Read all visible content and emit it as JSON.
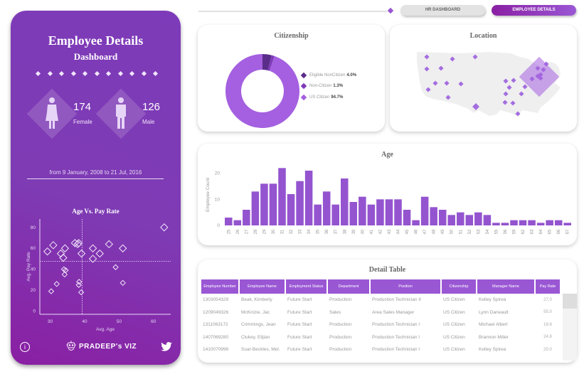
{
  "left_panel": {
    "title": "Employee Details",
    "subtitle": "Dashboard",
    "female": {
      "count": "174",
      "label": "Female"
    },
    "male": {
      "count": "126",
      "label": "Male"
    },
    "date_range": "from 9 January, 2008 to 21 Jul, 2016",
    "brand": "PRADEEP's VIZ",
    "icons": {
      "info": "info-icon",
      "brand": "robot-icon",
      "social": "twitter-icon"
    }
  },
  "nav": {
    "hr_dashboard": "HR DASHBOARD",
    "employee_details": "EMPLOYEE DETAILS"
  },
  "colors": {
    "accent": "#9a57d4",
    "panel": "#7e3bb9",
    "dark_purple": "#5b2d8a",
    "mid_purple": "#7e3bb9",
    "light_purple": "#a460e0"
  },
  "citizenship": {
    "title": "Citizenship",
    "legend": [
      {
        "label": "Eligible NonCitizen",
        "value": "4.0%",
        "color": "#5b2d8a"
      },
      {
        "label": "Non-Citizen",
        "value": "1.3%",
        "color": "#7e3bb9"
      },
      {
        "label": "US Citizen",
        "value": "94.7%",
        "color": "#a460e0"
      }
    ]
  },
  "location": {
    "title": "Location"
  },
  "age_chart": {
    "title": "Age"
  },
  "table": {
    "title": "Detail Table",
    "headers": [
      "Employee Number",
      "Employee Name",
      "Employment Status",
      "Department",
      "Position",
      "Citizenship",
      "Manager Name",
      "Pay Rate"
    ],
    "rows": [
      [
        "1303054329",
        "Beak, Kimberly",
        "Future Start",
        "Production",
        "Production Technician II",
        "US Citizen",
        "Kelley Spirea",
        "27.0"
      ],
      [
        "1209049326",
        "McKinzie, Jac",
        "Future Start",
        "Sales",
        "Area Sales Manager",
        "US Citizen",
        "Lynn Daneault",
        "55.0"
      ],
      [
        "1311063172",
        "Crimmings,   Jean",
        "Future Start",
        "Production",
        "Production Technician I",
        "US Citizen",
        "Michael Albert",
        "19.8"
      ],
      [
        "1407069280",
        "Clukey, Elijian",
        "Future Start",
        "Production",
        "Production Technician I",
        "US Citizen",
        "Brannon Miller",
        "24.8"
      ],
      [
        "1410070998",
        "Soar-Beckles, Mel.",
        "Future Start",
        "Production",
        "Production Technician I",
        "US Citizen",
        "Kelley Spirea",
        "20.0"
      ]
    ]
  },
  "chart_data": [
    {
      "type": "pie",
      "title": "Citizenship",
      "categories": [
        "Eligible NonCitizen",
        "Non-Citizen",
        "US Citizen"
      ],
      "values": [
        4.0,
        1.3,
        94.7
      ],
      "donut": true,
      "legend": "right"
    },
    {
      "type": "bar",
      "title": "Age",
      "xlabel": "",
      "ylabel": "Employee Count",
      "ylim": [
        0,
        24
      ],
      "yticks": [
        0,
        10,
        20
      ],
      "categories": [
        "25",
        "26",
        "27",
        "28",
        "29",
        "30",
        "31",
        "32",
        "33",
        "34",
        "35",
        "36",
        "37",
        "38",
        "39",
        "40",
        "41",
        "42",
        "43",
        "44",
        "45",
        "46",
        "47",
        "48",
        "49",
        "50",
        "51",
        "52",
        "53",
        "54",
        "55",
        "56",
        "59",
        "62",
        "63",
        "64",
        "65",
        "66",
        "67"
      ],
      "values": [
        3,
        2,
        6,
        13,
        16,
        16,
        22,
        12,
        17,
        21,
        8,
        13,
        8,
        18,
        9,
        11,
        8,
        10,
        10,
        10,
        6,
        2,
        11,
        7,
        6,
        4,
        5,
        4,
        5,
        4,
        1,
        1,
        2,
        2,
        2,
        1,
        2,
        2,
        1
      ]
    },
    {
      "type": "scatter",
      "title": "Age Vs. Pay Rate",
      "xlabel": "Avg. Age",
      "ylabel": "Avg. Pay Rate",
      "xlim": [
        27,
        65
      ],
      "ylim": [
        -3,
        88
      ],
      "xticks": [
        30,
        40,
        50,
        60
      ],
      "yticks": [
        0,
        20,
        40,
        60,
        80
      ],
      "reference_lines": {
        "x": 39.3,
        "y": 47.5
      },
      "points": [
        {
          "x": 29.2,
          "y": 57
        },
        {
          "x": 30.9,
          "y": 63
        },
        {
          "x": 33.1,
          "y": 55
        },
        {
          "x": 33.8,
          "y": 51
        },
        {
          "x": 34.3,
          "y": 60
        },
        {
          "x": 37.2,
          "y": 65
        },
        {
          "x": 38.0,
          "y": 64
        },
        {
          "x": 38.3,
          "y": 65
        },
        {
          "x": 39.1,
          "y": 55
        },
        {
          "x": 42.4,
          "y": 60
        },
        {
          "x": 42.4,
          "y": 50
        },
        {
          "x": 44.4,
          "y": 55
        },
        {
          "x": 47.1,
          "y": 64
        },
        {
          "x": 51.1,
          "y": 60
        },
        {
          "x": 63.1,
          "y": 80
        },
        {
          "x": 34.0,
          "y": 40
        },
        {
          "x": 34.5,
          "y": 39
        },
        {
          "x": 34.2,
          "y": 35
        },
        {
          "x": 49.0,
          "y": 42
        },
        {
          "x": 31.9,
          "y": 26
        },
        {
          "x": 38.4,
          "y": 28
        },
        {
          "x": 38.3,
          "y": 25
        },
        {
          "x": 51.1,
          "y": 27
        },
        {
          "x": 30.3,
          "y": 19
        },
        {
          "x": 39.0,
          "y": 18
        }
      ]
    }
  ]
}
